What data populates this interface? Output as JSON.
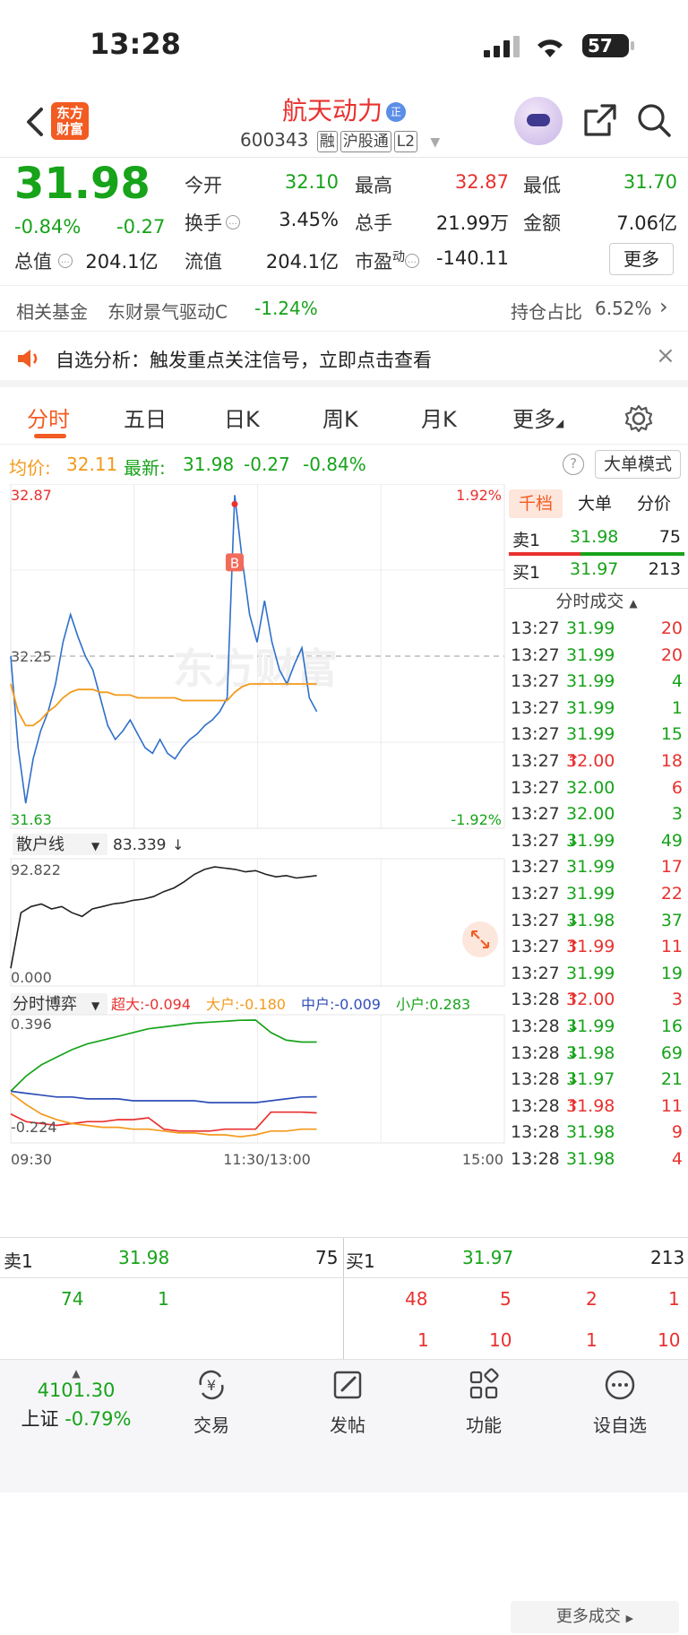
{
  "status_bar": {
    "time": "13:28",
    "battery": "57"
  },
  "header": {
    "logo_text": "东方财富",
    "stock_name": "航天动力",
    "badge": "正",
    "code": "600343",
    "tags": [
      "融",
      "沪股通",
      "L2"
    ]
  },
  "quote": {
    "price": "31.98",
    "pct": "-0.84%",
    "chg": "-0.27",
    "fields": [
      {
        "label": "今开",
        "value": "32.10",
        "color": "#17a31a"
      },
      {
        "label": "最高",
        "value": "32.87",
        "color": "#e8312f"
      },
      {
        "label": "最低",
        "value": "31.70",
        "color": "#17a31a"
      },
      {
        "label": "换手",
        "value": "3.45%",
        "color": "#222222"
      },
      {
        "label": "总手",
        "value": "21.99万",
        "color": "#222222"
      },
      {
        "label": "金额",
        "value": "7.06亿",
        "color": "#222222"
      },
      {
        "label": "总值",
        "value": "204.1亿",
        "color": "#222222"
      },
      {
        "label": "流值",
        "value": "204.1亿",
        "color": "#222222"
      },
      {
        "label": "市盈",
        "value": "-140.11",
        "color": "#222222"
      }
    ],
    "pe_sup": "动",
    "more_button": "更多"
  },
  "fund_row": {
    "label": "相关基金",
    "fund_name": "东财景气驱动C",
    "fund_pct": "-1.24%",
    "holding_label": "持仓占比",
    "holding_value": "6.52%"
  },
  "notice": {
    "text": "自选分析：触发重点关注信号，立即点击查看"
  },
  "tabs": [
    "分时",
    "五日",
    "日K",
    "周K",
    "月K",
    "更多"
  ],
  "avg_line": {
    "avg_label": "均价:",
    "avg_value": "32.11",
    "latest_label": "最新:",
    "latest_value": "31.98",
    "chg": "-0.27",
    "pct": "-0.84%",
    "big_mode": "大单模式"
  },
  "chart_data": [
    {
      "type": "line",
      "title": "分时",
      "ylim": [
        31.63,
        32.87
      ],
      "y_labels": {
        "top": "32.87",
        "mid": "32.25",
        "bottom": "31.63",
        "top_pct": "1.92%",
        "bottom_pct": "-1.92%"
      },
      "x_labels": [
        "09:30",
        "11:30/13:00",
        "15:00"
      ],
      "marker": "B",
      "series": [
        {
          "color": "#2f6fc9",
          "values": [
            32.25,
            31.92,
            31.72,
            31.88,
            31.98,
            32.05,
            32.15,
            32.3,
            32.4,
            32.32,
            32.25,
            32.2,
            32.1,
            32.0,
            31.95,
            31.98,
            32.02,
            31.97,
            31.92,
            31.9,
            31.95,
            31.9,
            31.88,
            31.92,
            31.95,
            31.97,
            32.0,
            32.02,
            32.05,
            32.1,
            32.83,
            32.6,
            32.4,
            32.3,
            32.45,
            32.3,
            32.2,
            32.15,
            32.22,
            32.28,
            32.1,
            32.05
          ]
        },
        {
          "color": "#f39a1b",
          "values": [
            32.15,
            32.05,
            32.0,
            32.0,
            32.02,
            32.05,
            32.07,
            32.1,
            32.12,
            32.13,
            32.13,
            32.13,
            32.12,
            32.12,
            32.11,
            32.11,
            32.11,
            32.1,
            32.1,
            32.1,
            32.1,
            32.1,
            32.1,
            32.09,
            32.09,
            32.09,
            32.09,
            32.09,
            32.09,
            32.09,
            32.12,
            32.14,
            32.15,
            32.15,
            32.15,
            32.15,
            32.15,
            32.15,
            32.15,
            32.15,
            32.15,
            32.15
          ]
        }
      ]
    },
    {
      "type": "line",
      "title": "散户线",
      "value_label": "83.339",
      "ylim": [
        0.0,
        92.822
      ],
      "y_labels": {
        "top": "92.822",
        "bottom": "0.000"
      },
      "series": [
        {
          "color": "#222222",
          "values": [
            10,
            55,
            60,
            62,
            58,
            60,
            55,
            52,
            58,
            60,
            62,
            63,
            65,
            66,
            68,
            72,
            75,
            80,
            86,
            90,
            92,
            91,
            90,
            88,
            89,
            86,
            84,
            85,
            83,
            84,
            85
          ]
        }
      ]
    },
    {
      "type": "line",
      "title": "分时博弈",
      "legend": [
        {
          "name": "超大",
          "value": "-0.094",
          "color": "#e8312f"
        },
        {
          "name": "大户",
          "value": "-0.180",
          "color": "#f39a1b"
        },
        {
          "name": "中户",
          "value": "-0.009",
          "color": "#2f4fb8"
        },
        {
          "name": "小户",
          "value": "0.283",
          "color": "#17a31a"
        }
      ],
      "ylim": [
        -0.224,
        0.396
      ],
      "y_labels": {
        "top": "0.396",
        "bottom": "-0.224"
      },
      "series": [
        {
          "color": "#17a31a",
          "values": [
            0.02,
            0.1,
            0.16,
            0.2,
            0.24,
            0.27,
            0.29,
            0.31,
            0.33,
            0.35,
            0.36,
            0.37,
            0.38,
            0.385,
            0.39,
            0.395,
            0.396,
            0.33,
            0.29,
            0.28,
            0.28
          ]
        },
        {
          "color": "#2f4fb8",
          "values": [
            0.02,
            0.01,
            0.0,
            -0.01,
            -0.01,
            -0.02,
            -0.02,
            -0.02,
            -0.03,
            -0.03,
            -0.03,
            -0.03,
            -0.03,
            -0.04,
            -0.04,
            -0.04,
            -0.04,
            -0.03,
            -0.02,
            -0.01,
            -0.009
          ]
        },
        {
          "color": "#e8312f",
          "values": [
            -0.1,
            -0.14,
            -0.15,
            -0.16,
            -0.15,
            -0.14,
            -0.14,
            -0.13,
            -0.13,
            -0.12,
            -0.18,
            -0.19,
            -0.19,
            -0.19,
            -0.18,
            -0.18,
            -0.18,
            -0.09,
            -0.09,
            -0.09,
            -0.094
          ]
        },
        {
          "color": "#f39a1b",
          "values": [
            0.01,
            -0.05,
            -0.1,
            -0.13,
            -0.15,
            -0.16,
            -0.17,
            -0.17,
            -0.18,
            -0.18,
            -0.19,
            -0.2,
            -0.2,
            -0.21,
            -0.21,
            -0.22,
            -0.21,
            -0.19,
            -0.19,
            -0.18,
            -0.18
          ]
        }
      ]
    }
  ],
  "right_panel": {
    "tabs": [
      "千档",
      "大单",
      "分价"
    ],
    "sell1": {
      "label": "卖1",
      "price": "31.98",
      "vol": "75"
    },
    "buy1": {
      "label": "买1",
      "price": "31.97",
      "vol": "213"
    },
    "trades_title": "分时成交",
    "trades": [
      {
        "time": "13:27",
        "price": "31.99",
        "vol": "20",
        "arrow": "",
        "vcolor": "#e8312f"
      },
      {
        "time": "13:27",
        "price": "31.99",
        "vol": "20",
        "arrow": "",
        "vcolor": "#e8312f"
      },
      {
        "time": "13:27",
        "price": "31.99",
        "vol": "4",
        "arrow": "",
        "vcolor": "#17a31a"
      },
      {
        "time": "13:27",
        "price": "31.99",
        "vol": "1",
        "arrow": "",
        "vcolor": "#17a31a"
      },
      {
        "time": "13:27",
        "price": "31.99",
        "vol": "15",
        "arrow": "",
        "vcolor": "#17a31a"
      },
      {
        "time": "13:27",
        "price": "32.00",
        "vol": "18",
        "arrow": "↑",
        "vcolor": "#e8312f"
      },
      {
        "time": "13:27",
        "price": "32.00",
        "vol": "6",
        "arrow": "",
        "vcolor": "#e8312f"
      },
      {
        "time": "13:27",
        "price": "32.00",
        "vol": "3",
        "arrow": "",
        "vcolor": "#17a31a"
      },
      {
        "time": "13:27",
        "price": "31.99",
        "vol": "49",
        "arrow": "↓",
        "vcolor": "#17a31a"
      },
      {
        "time": "13:27",
        "price": "31.99",
        "vol": "17",
        "arrow": "",
        "vcolor": "#e8312f"
      },
      {
        "time": "13:27",
        "price": "31.99",
        "vol": "22",
        "arrow": "",
        "vcolor": "#e8312f"
      },
      {
        "time": "13:27",
        "price": "31.98",
        "vol": "37",
        "arrow": "↓",
        "vcolor": "#17a31a"
      },
      {
        "time": "13:27",
        "price": "31.99",
        "vol": "11",
        "arrow": "↑",
        "vcolor": "#e8312f"
      },
      {
        "time": "13:27",
        "price": "31.99",
        "vol": "19",
        "arrow": "",
        "vcolor": "#17a31a"
      },
      {
        "time": "13:28",
        "price": "32.00",
        "vol": "3",
        "arrow": "↑",
        "vcolor": "#e8312f"
      },
      {
        "time": "13:28",
        "price": "31.99",
        "vol": "16",
        "arrow": "↓",
        "vcolor": "#17a31a"
      },
      {
        "time": "13:28",
        "price": "31.98",
        "vol": "69",
        "arrow": "↓",
        "vcolor": "#17a31a"
      },
      {
        "time": "13:28",
        "price": "31.97",
        "vol": "21",
        "arrow": "↓",
        "vcolor": "#17a31a"
      },
      {
        "time": "13:28",
        "price": "31.98",
        "vol": "11",
        "arrow": "↑",
        "vcolor": "#e8312f"
      },
      {
        "time": "13:28",
        "price": "31.98",
        "vol": "9",
        "arrow": "",
        "vcolor": "#e8312f"
      },
      {
        "time": "13:28",
        "price": "31.98",
        "vol": "4",
        "arrow": "",
        "vcolor": "#e8312f"
      }
    ],
    "more_trades": "更多成交"
  },
  "orderbook": {
    "sell_label": "卖1",
    "sell_price": "31.98",
    "sell_vol": "75",
    "buy_label": "买1",
    "buy_price": "31.97",
    "buy_vol": "213",
    "sell_detail": [
      "74",
      "1"
    ],
    "buy_detail_row1": [
      "48",
      "5",
      "2",
      "1"
    ],
    "buy_detail_row2": [
      "1",
      "10",
      "1",
      "10"
    ]
  },
  "bottom_nav": {
    "index_value": "4101.30",
    "index_name": "上证",
    "index_pct": "-0.79%",
    "items": [
      "交易",
      "发帖",
      "功能",
      "设自选"
    ]
  }
}
